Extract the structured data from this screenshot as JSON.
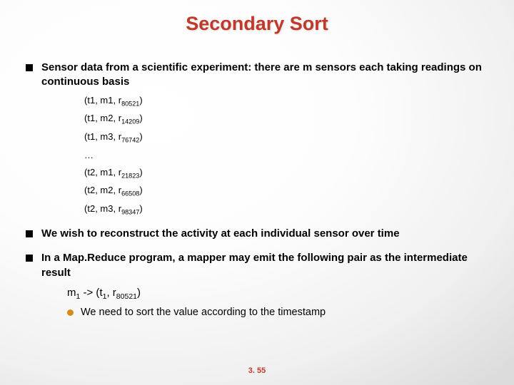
{
  "title": "Secondary Sort",
  "bullets": {
    "b1": "Sensor data from a scientific experiment: there are m sensors each taking readings on continuous basis",
    "b2": "We wish to reconstruct the activity at each individual sensor over time",
    "b3": "In a Map.Reduce program, a mapper may emit the following pair as the intermediate result",
    "sub1": "We need to sort the value according to the timestamp"
  },
  "tuples": {
    "t0": {
      "a": "t1",
      "b": "m1",
      "c": "r",
      "s": "80521"
    },
    "t1": {
      "a": "t1",
      "b": "m2",
      "c": "r",
      "s": "14209"
    },
    "t2": {
      "a": "t1",
      "b": "m3",
      "c": "r",
      "s": "76742"
    },
    "ell": "…",
    "t3": {
      "a": "t2",
      "b": "m1",
      "c": "r",
      "s": "21823"
    },
    "t4": {
      "a": "t2",
      "b": "m2",
      "c": "r",
      "s": "66508"
    },
    "t5": {
      "a": "t2",
      "b": "m3",
      "c": "r",
      "s": "98347"
    }
  },
  "mapline": {
    "m": "m",
    "ms": "1",
    "arrow": " -> (",
    "t": "t",
    "ts": "1",
    "comma": ", r",
    "rs": "80521",
    "close": ")"
  },
  "pagenum": "3. 55"
}
